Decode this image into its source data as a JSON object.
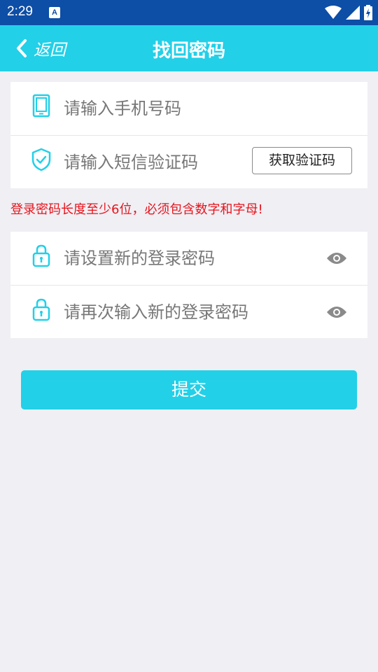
{
  "status_bar": {
    "time": "2:29",
    "notification_letter": "A"
  },
  "nav": {
    "back_label": "返回",
    "title": "找回密码"
  },
  "verify_card": {
    "phone_placeholder": "请输入手机号码",
    "sms_placeholder": "请输入短信验证码",
    "get_code_label": "获取验证码"
  },
  "warning": "登录密码长度至少6位，必须包含数字和字母!",
  "password_card": {
    "new_password_placeholder": "请设置新的登录密码",
    "confirm_password_placeholder": "请再次输入新的登录密码"
  },
  "submit_label": "提交",
  "colors": {
    "accent": "#22d0e8",
    "status_bar": "#0d4ea6",
    "warning": "#e8141c",
    "background": "#efeff4"
  },
  "icons": [
    "phone-icon",
    "shield-check-icon",
    "lock-icon",
    "eye-icon",
    "chevron-left-icon",
    "wifi-icon",
    "signal-icon",
    "battery-icon"
  ]
}
